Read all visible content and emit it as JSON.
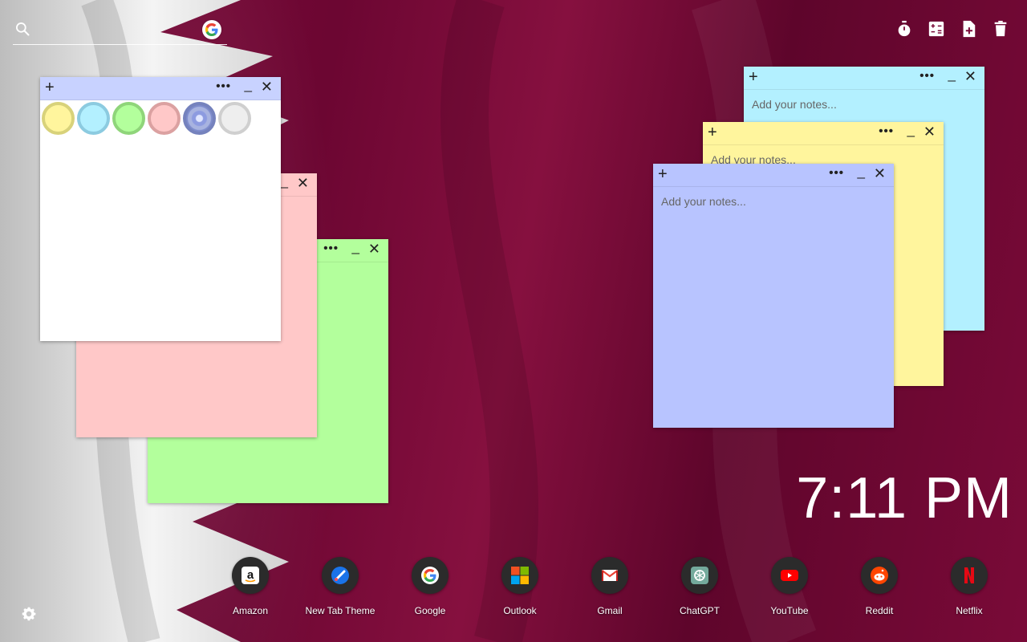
{
  "search": {
    "placeholder": ""
  },
  "top_tools": [
    "timer-icon",
    "calculator-icon",
    "new-note-icon",
    "trash-icon"
  ],
  "notes_placeholder": "Add your notes...",
  "note_controls": {
    "plus": "+",
    "more": "•••",
    "minimize": "_",
    "close": "✕"
  },
  "color_palette": [
    "#fff59d",
    "#b3f0ff",
    "#b3ff9c",
    "#ffc8c8",
    "#a8b3e0",
    "#eeeeee"
  ],
  "notes": [
    {
      "id": "white-picker",
      "color": "#ffffff",
      "bar": "#c8d2ff"
    },
    {
      "id": "pink",
      "color": "#ffc8c8"
    },
    {
      "id": "green",
      "color": "#b3ff9c"
    },
    {
      "id": "cyan",
      "color": "#b3f0ff"
    },
    {
      "id": "yellow",
      "color": "#fff59d"
    },
    {
      "id": "blue",
      "color": "#b8c4ff"
    }
  ],
  "clock": {
    "time": "7:11 PM"
  },
  "apps": [
    {
      "label": "Amazon",
      "icon": "amazon-icon"
    },
    {
      "label": "New Tab Theme",
      "icon": "new-tab-theme-icon"
    },
    {
      "label": "Google",
      "icon": "google-icon"
    },
    {
      "label": "Outlook",
      "icon": "outlook-icon"
    },
    {
      "label": "Gmail",
      "icon": "gmail-icon"
    },
    {
      "label": "ChatGPT",
      "icon": "chatgpt-icon"
    },
    {
      "label": "YouTube",
      "icon": "youtube-icon"
    },
    {
      "label": "Reddit",
      "icon": "reddit-icon"
    },
    {
      "label": "Netflix",
      "icon": "netflix-icon"
    }
  ]
}
